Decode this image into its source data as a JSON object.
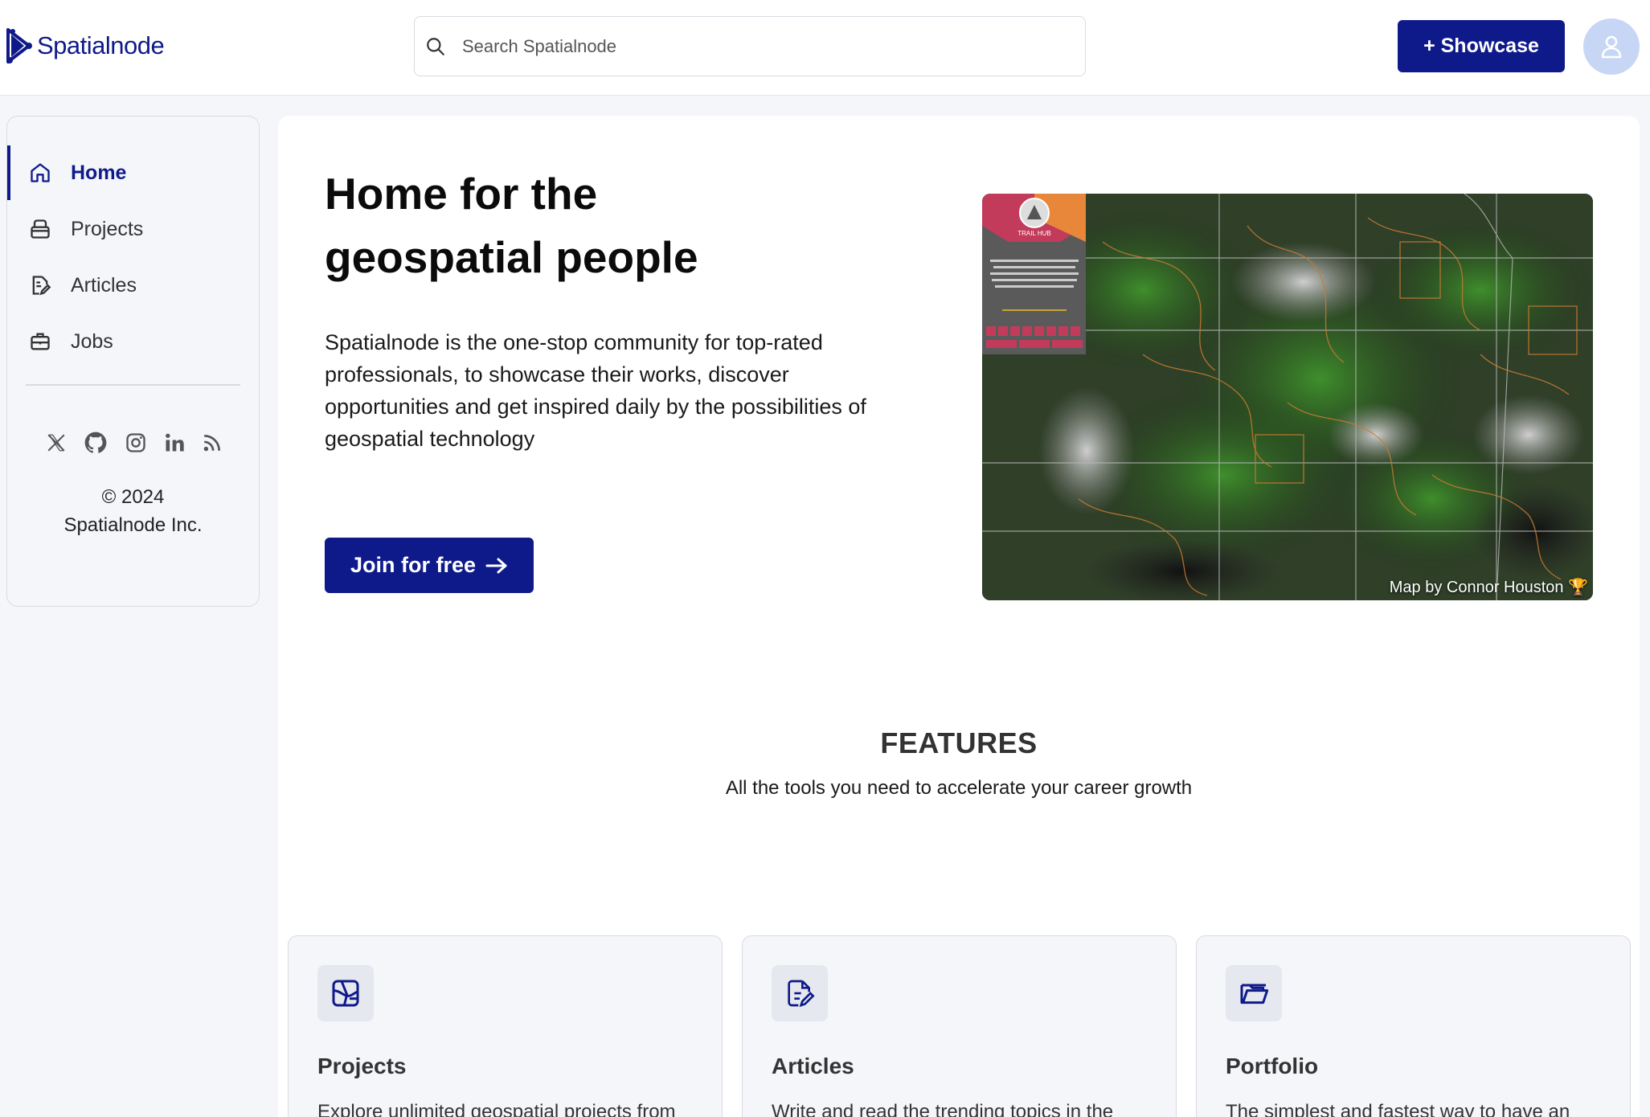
{
  "header": {
    "logo_text": "Spatialnode",
    "search_placeholder": "Search Spatialnode",
    "showcase_label": "+ Showcase"
  },
  "sidebar": {
    "items": [
      {
        "label": "Home",
        "icon": "home-icon",
        "active": true
      },
      {
        "label": "Projects",
        "icon": "projects-icon",
        "active": false
      },
      {
        "label": "Articles",
        "icon": "articles-icon",
        "active": false
      },
      {
        "label": "Jobs",
        "icon": "briefcase-icon",
        "active": false
      }
    ],
    "socials": [
      "x-icon",
      "github-icon",
      "instagram-icon",
      "linkedin-icon",
      "rss-icon"
    ],
    "copyright_line1": "© 2024",
    "copyright_line2": "Spatialnode Inc."
  },
  "hero": {
    "title_line1": "Home for the",
    "title_line2": "geospatial people",
    "description": "Spatialnode is the one-stop community for top-rated professionals, to showcase their works, discover opportunities and get inspired daily by the possibilities of geospatial technology",
    "cta_label": "Join for free",
    "map_credit": "Map by Connor Houston 🏆",
    "map_panel_title": "TRAIL HUB"
  },
  "features": {
    "title": "FEATURES",
    "subtitle": "All the tools you need to accelerate your career growth",
    "cards": [
      {
        "title": "Projects",
        "description": "Explore unlimited geospatial projects from",
        "icon": "map-icon"
      },
      {
        "title": "Articles",
        "description": "Write and read the trending topics in the",
        "icon": "document-edit-icon"
      },
      {
        "title": "Portfolio",
        "description": "The simplest and fastest way to have an",
        "icon": "folder-open-icon"
      }
    ]
  },
  "colors": {
    "brand": "#0f1a8a",
    "background": "#f5f6fa",
    "avatar_bg": "#c8d6f6"
  }
}
